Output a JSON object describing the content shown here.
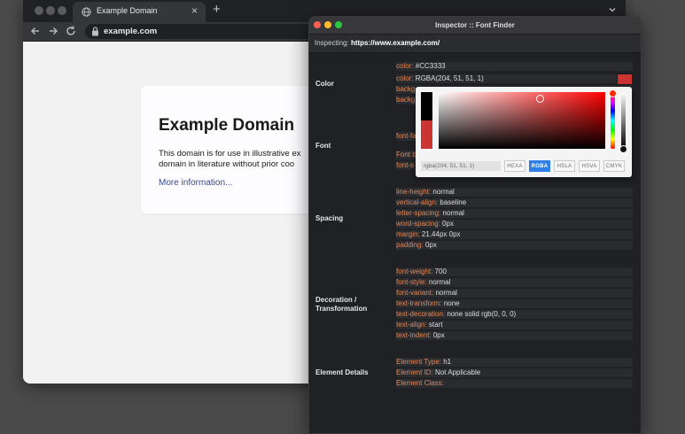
{
  "browser": {
    "tab_title": "Example Domain",
    "new_tab": "+",
    "url": "example.com"
  },
  "page": {
    "heading": "Example Domain",
    "para_line1": "This domain is for use in illustrative ex",
    "para_line2": "domain in literature without prior coo",
    "link": "More information..."
  },
  "inspector": {
    "title": "Inspector :: Font Finder",
    "inspecting_label": "Inspecting:",
    "inspecting_url": "https://www.example.com/",
    "sections": {
      "color": "Color",
      "font": "Font",
      "spacing": "Spacing",
      "decoration_1": "Decoration /",
      "decoration_2": "Transformation",
      "details": "Element Details"
    },
    "color_props": [
      {
        "k": "color:",
        "v": "#CC3333"
      },
      {
        "k": "color:",
        "v": "RGBA(204, 51, 51, 1)"
      },
      {
        "k": "backg",
        "v": ""
      },
      {
        "k": "backg",
        "v": ""
      }
    ],
    "font_props": [
      {
        "k": "font-fa",
        "v": ""
      },
      {
        "k": "Font b",
        "v": ""
      },
      {
        "k": "font-s",
        "v": ""
      }
    ],
    "spacing_props": [
      {
        "k": "line-height:",
        "v": "normal"
      },
      {
        "k": "vertical-align:",
        "v": "baseline"
      },
      {
        "k": "letter-spacing:",
        "v": "normal"
      },
      {
        "k": "word-spacing:",
        "v": "0px"
      },
      {
        "k": "margin:",
        "v": "21.44px 0px"
      },
      {
        "k": "padding:",
        "v": "0px"
      }
    ],
    "decoration_props": [
      {
        "k": "font-weight:",
        "v": "700"
      },
      {
        "k": "font-style:",
        "v": "normal"
      },
      {
        "k": "font-variant:",
        "v": "normal"
      },
      {
        "k": "text-transform:",
        "v": "none"
      },
      {
        "k": "text-decoration:",
        "v": "none solid rgb(0, 0, 0)"
      },
      {
        "k": "text-align:",
        "v": "start"
      },
      {
        "k": "text-indent:",
        "v": "0px"
      }
    ],
    "details_props": [
      {
        "k": "Element Type:",
        "v": "h1"
      },
      {
        "k": "Element ID:",
        "v": "Not Applicable"
      },
      {
        "k": "Element Class:",
        "v": ""
      }
    ],
    "swatch_color": "#CC3333"
  },
  "picker": {
    "value": "rgba(204, 51, 51, 1)",
    "formats": [
      "HEXA",
      "RGBA",
      "HSLA",
      "HSVA",
      "CMYK"
    ],
    "active_format": "RGBA"
  }
}
